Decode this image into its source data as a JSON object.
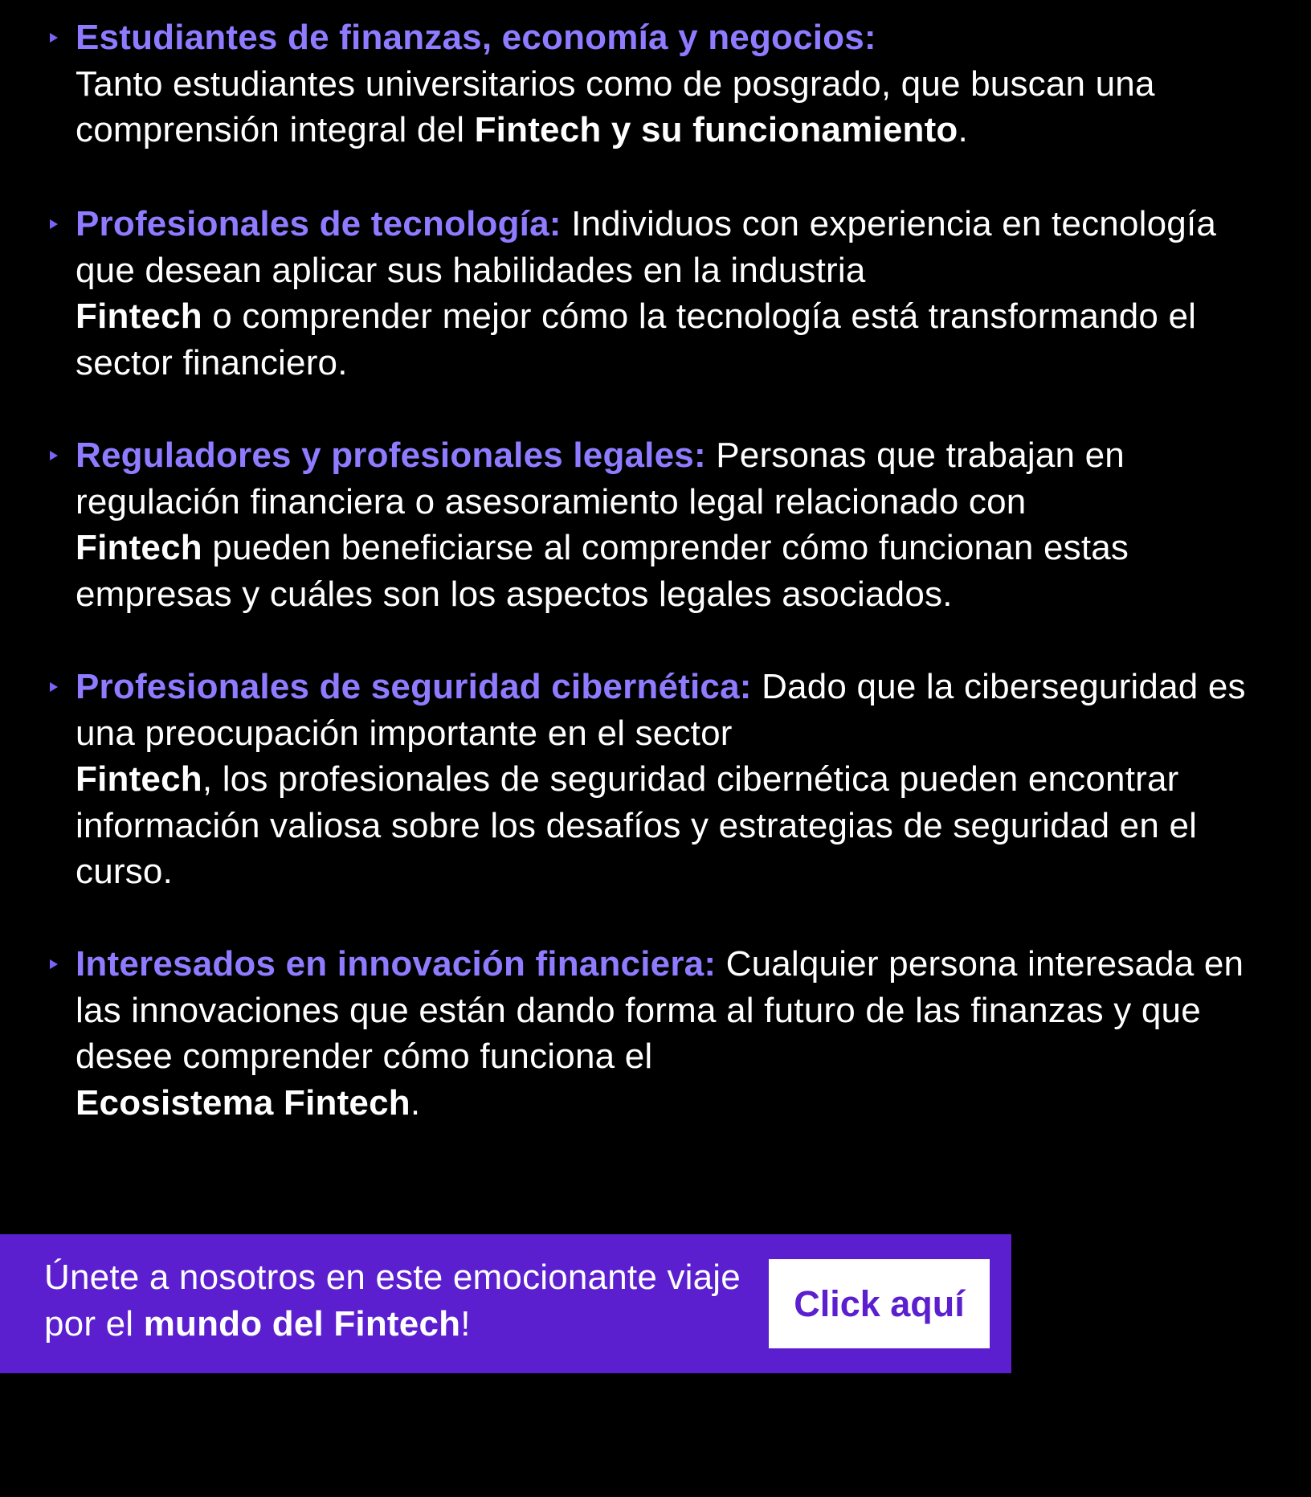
{
  "items": [
    {
      "heading": "Estudiantes de finanzas, economía y negocios:",
      "text_1": "Tanto estudiantes universitarios como de posgrado, que buscan una comprensión integral del ",
      "bold_1": "Fintech y su funcionamiento",
      "text_2": "."
    },
    {
      "heading": "Profesionales de tecnología:",
      "text_1": " Individuos con experiencia en tecnología que desean aplicar sus habilidades en la industria ",
      "bold_1": "Fintech",
      "text_2": " o comprender mejor cómo la tecnología está transformando el sector financiero."
    },
    {
      "heading": "Reguladores y profesionales legales:",
      "text_1": " Personas que trabajan en regulación financiera o asesoramiento legal relacionado con ",
      "bold_1": "Fintech",
      "text_2": " pueden beneficiarse al comprender cómo funcionan estas empresas y cuáles son los aspectos legales asociados."
    },
    {
      "heading": "Profesionales de seguridad cibernética:",
      "text_1": " Dado que la ciberseguridad es una preocupación importante en el sector ",
      "bold_1": "Fintech",
      "text_2": ", los profesionales de seguridad cibernética pueden encontrar información valiosa sobre los desafíos y estrategias de seguridad en el curso."
    },
    {
      "heading": "Interesados en innovación financiera:",
      "text_1": " Cualquier persona interesada en las innovaciones que están dando forma al futuro de las finanzas y que desee comprender cómo funciona el ",
      "bold_1": "Ecosistema Fintech",
      "text_2": "."
    }
  ],
  "cta": {
    "text_1": "Únete a nosotros en este emocionante viaje por el ",
    "bold": "mundo del Fintech",
    "text_2": "!",
    "button_label": "Click aquí"
  },
  "colors": {
    "background": "#000000",
    "heading": "#8f7bff",
    "bullet": "#7b63f5",
    "banner": "#5b1fcf",
    "button_text": "#5b1fcf"
  }
}
